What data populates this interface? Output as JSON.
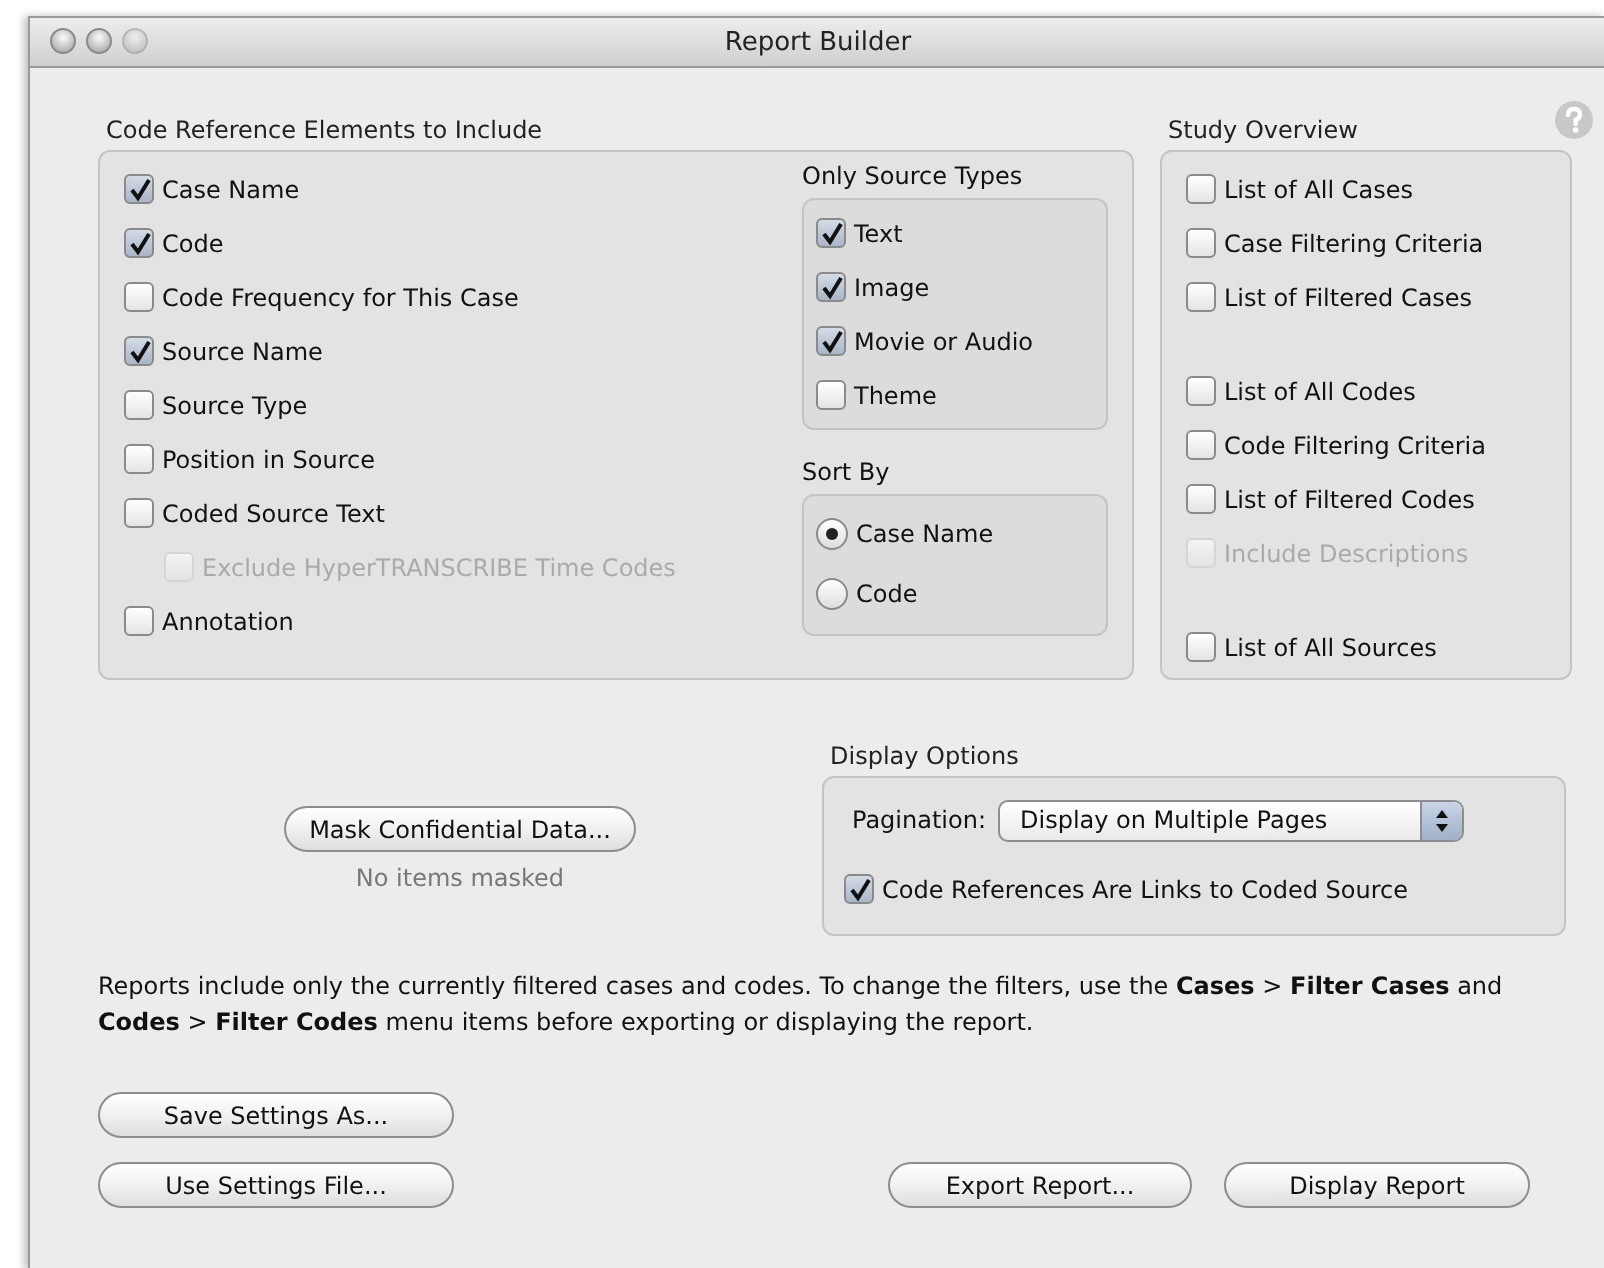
{
  "window": {
    "title": "Report Builder"
  },
  "code_elements": {
    "title": "Code Reference Elements to Include",
    "items": [
      {
        "label": "Case Name",
        "checked": true,
        "disabled": false
      },
      {
        "label": "Code",
        "checked": true,
        "disabled": false
      },
      {
        "label": "Code Frequency for This Case",
        "checked": false,
        "disabled": false
      },
      {
        "label": "Source Name",
        "checked": true,
        "disabled": false
      },
      {
        "label": "Source Type",
        "checked": false,
        "disabled": false
      },
      {
        "label": "Position in Source",
        "checked": false,
        "disabled": false
      },
      {
        "label": "Coded Source Text",
        "checked": false,
        "disabled": false,
        "children": [
          {
            "label": "Exclude HyperTRANSCRIBE Time Codes",
            "checked": false,
            "disabled": true
          }
        ]
      },
      {
        "label": "Annotation",
        "checked": false,
        "disabled": false
      }
    ]
  },
  "source_types": {
    "title": "Only Source Types",
    "items": [
      {
        "label": "Text",
        "checked": true,
        "disabled": false
      },
      {
        "label": "Image",
        "checked": true,
        "disabled": false
      },
      {
        "label": "Movie or Audio",
        "checked": true,
        "disabled": false
      },
      {
        "label": "Theme",
        "checked": false,
        "disabled": false
      }
    ]
  },
  "sort_by": {
    "title": "Sort By",
    "options": [
      {
        "label": "Case Name",
        "selected": true
      },
      {
        "label": "Code",
        "selected": false
      }
    ]
  },
  "study_overview": {
    "title": "Study Overview",
    "groups": [
      {
        "items": [
          {
            "label": "List of All Cases",
            "checked": false,
            "disabled": false
          },
          {
            "label": "Case Filtering Criteria",
            "checked": false,
            "disabled": false
          },
          {
            "label": "List of Filtered Cases",
            "checked": false,
            "disabled": false
          }
        ]
      },
      {
        "items": [
          {
            "label": "List of All Codes",
            "checked": false,
            "disabled": false
          },
          {
            "label": "Code Filtering Criteria",
            "checked": false,
            "disabled": false
          },
          {
            "label": "List of Filtered Codes",
            "checked": false,
            "disabled": false
          },
          {
            "label": "Include Descriptions",
            "checked": false,
            "disabled": true
          }
        ]
      },
      {
        "items": [
          {
            "label": "List of All Sources",
            "checked": false,
            "disabled": false
          }
        ]
      }
    ]
  },
  "mask": {
    "button": "Mask Confidential Data...",
    "note": "No items masked"
  },
  "display_options": {
    "title": "Display Options",
    "pagination_label": "Pagination:",
    "pagination_value": "Display on Multiple Pages",
    "links": {
      "label": "Code References Are Links to Coded Source",
      "checked": true,
      "disabled": false
    }
  },
  "note": "Reports include only the currently filtered cases and codes. To change the filters, use the **Cases** > **Filter Cases** and **Codes** > **Filter Codes** menu items before exporting or displaying the report.",
  "buttons": {
    "save_settings": "Save Settings As...",
    "use_settings": "Use Settings File...",
    "export": "Export Report...",
    "display": "Display Report"
  }
}
